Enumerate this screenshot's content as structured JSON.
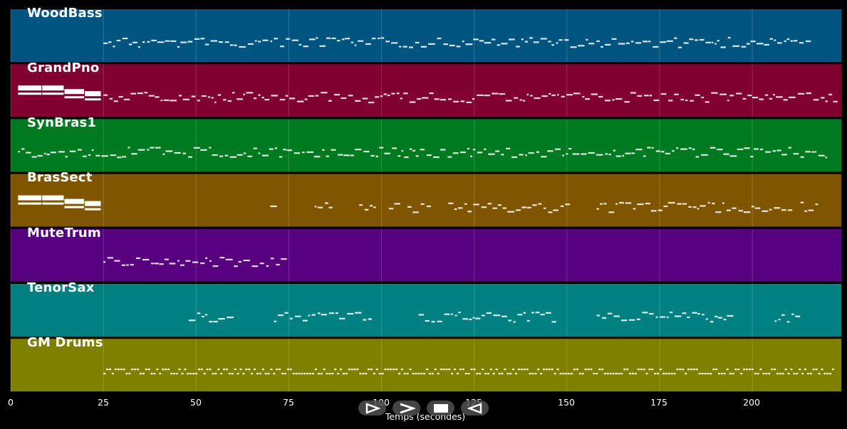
{
  "tracks": [
    {
      "name": "WoodBass",
      "color": "#005580",
      "density": "full",
      "start": 25,
      "end": 216
    },
    {
      "name": "GrandPno",
      "color": "#800030",
      "density": "full",
      "start": 25,
      "end": 222
    },
    {
      "name": "SynBras1",
      "color": "#007a20",
      "density": "full",
      "start": 2,
      "end": 220
    },
    {
      "name": "BrasSect",
      "color": "#7f5500",
      "density": "sparse",
      "start": 70,
      "end": 222
    },
    {
      "name": "MuteTrum",
      "color": "#570080",
      "density": "short",
      "start": 25,
      "end": 73
    },
    {
      "name": "TenorSax",
      "color": "#008080",
      "density": "phrases",
      "start": 48,
      "end": 212
    },
    {
      "name": "GM Drums",
      "color": "#808000",
      "density": "drums",
      "start": 25,
      "end": 222
    }
  ],
  "axis": {
    "title": "Temps (secondes)",
    "ticks": [
      "0",
      "25",
      "50",
      "75",
      "100",
      "125",
      "150",
      "175",
      "200"
    ],
    "tick_values": [
      0,
      25,
      50,
      75,
      100,
      125,
      150,
      175,
      200
    ],
    "range": [
      0,
      224
    ]
  },
  "controls": [
    {
      "name": "play-from-start",
      "icon": "play-outline-icon"
    },
    {
      "name": "play",
      "icon": "play-icon"
    },
    {
      "name": "stop",
      "icon": "stop-icon"
    },
    {
      "name": "rewind",
      "icon": "rewind-icon"
    }
  ]
}
